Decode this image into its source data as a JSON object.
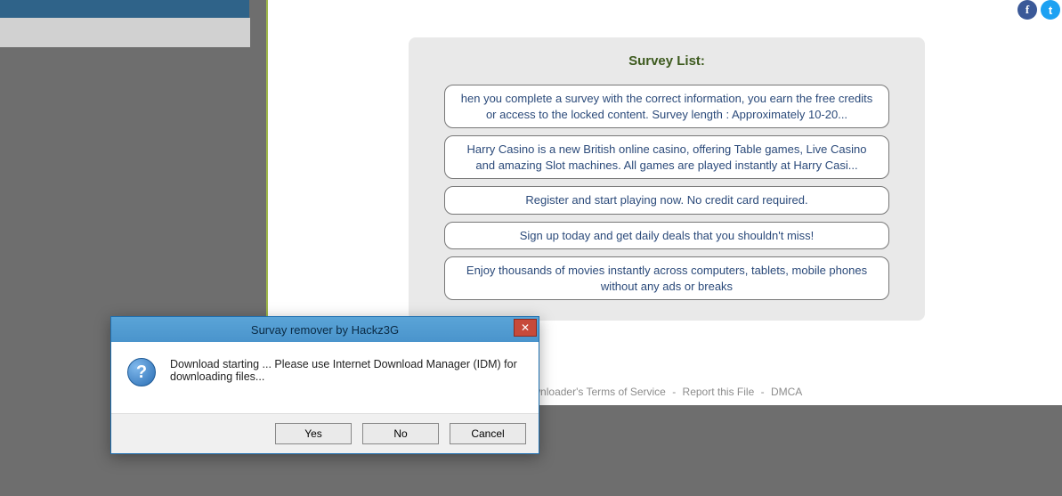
{
  "survey": {
    "title": "Survey List:",
    "items": [
      "hen you complete a survey with the correct information, you earn the free credits or access to the locked content. Survey length : Approximately 10-20...",
      "Harry Casino is a new British online casino, offering Table games, Live Casino and amazing Slot machines. All games are played instantly at Harry Casi...",
      "Register and start playing now. No credit card required.",
      "Sign up today and get daily deals that you shouldn't miss!",
      "Enjoy thousands of movies instantly across computers, tablets, mobile phones without any ads or breaks"
    ]
  },
  "footer": {
    "tos": "ownloader's Terms of Service",
    "report": "Report this File",
    "dmca": "DMCA"
  },
  "dialog": {
    "title": "Survay remover by Hackz3G",
    "message": "Download starting ... Please use Internet Download Manager (IDM) for downloading files...",
    "yes": "Yes",
    "no": "No",
    "cancel": "Cancel",
    "close": "✕",
    "question": "?"
  },
  "social": {
    "fb": "f",
    "tw": "t"
  }
}
